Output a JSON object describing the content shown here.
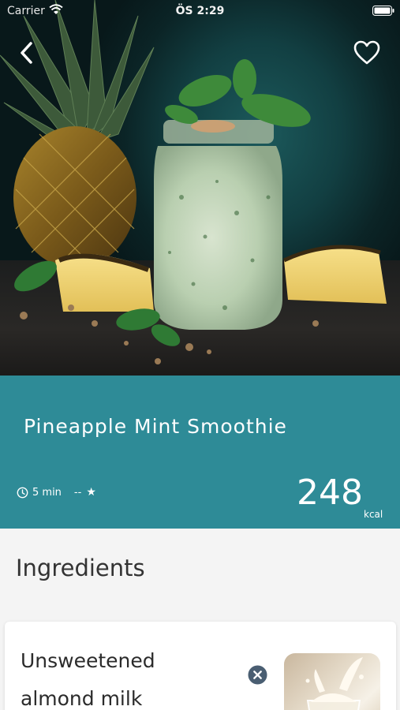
{
  "status_bar": {
    "carrier": "Carrier",
    "time": "ÖS 2:29"
  },
  "hero": {
    "image_subject": "pineapple mint smoothie in a mason jar with pineapple and mint leaves",
    "back_icon": "chevron-left-icon",
    "favorite_icon": "heart-outline-icon"
  },
  "recipe": {
    "title": "Pineapple Mint Smoothie",
    "time": "5 min",
    "rating": "--",
    "calories": "248",
    "calories_unit": "kcal",
    "header_color": "#2e8b97"
  },
  "ingredients": {
    "section_title": "Ingredients",
    "items": [
      {
        "name": "Unsweetened almond milk",
        "remove_icon": "close-circle-icon",
        "image_subject": "milk splash in glass"
      }
    ]
  }
}
